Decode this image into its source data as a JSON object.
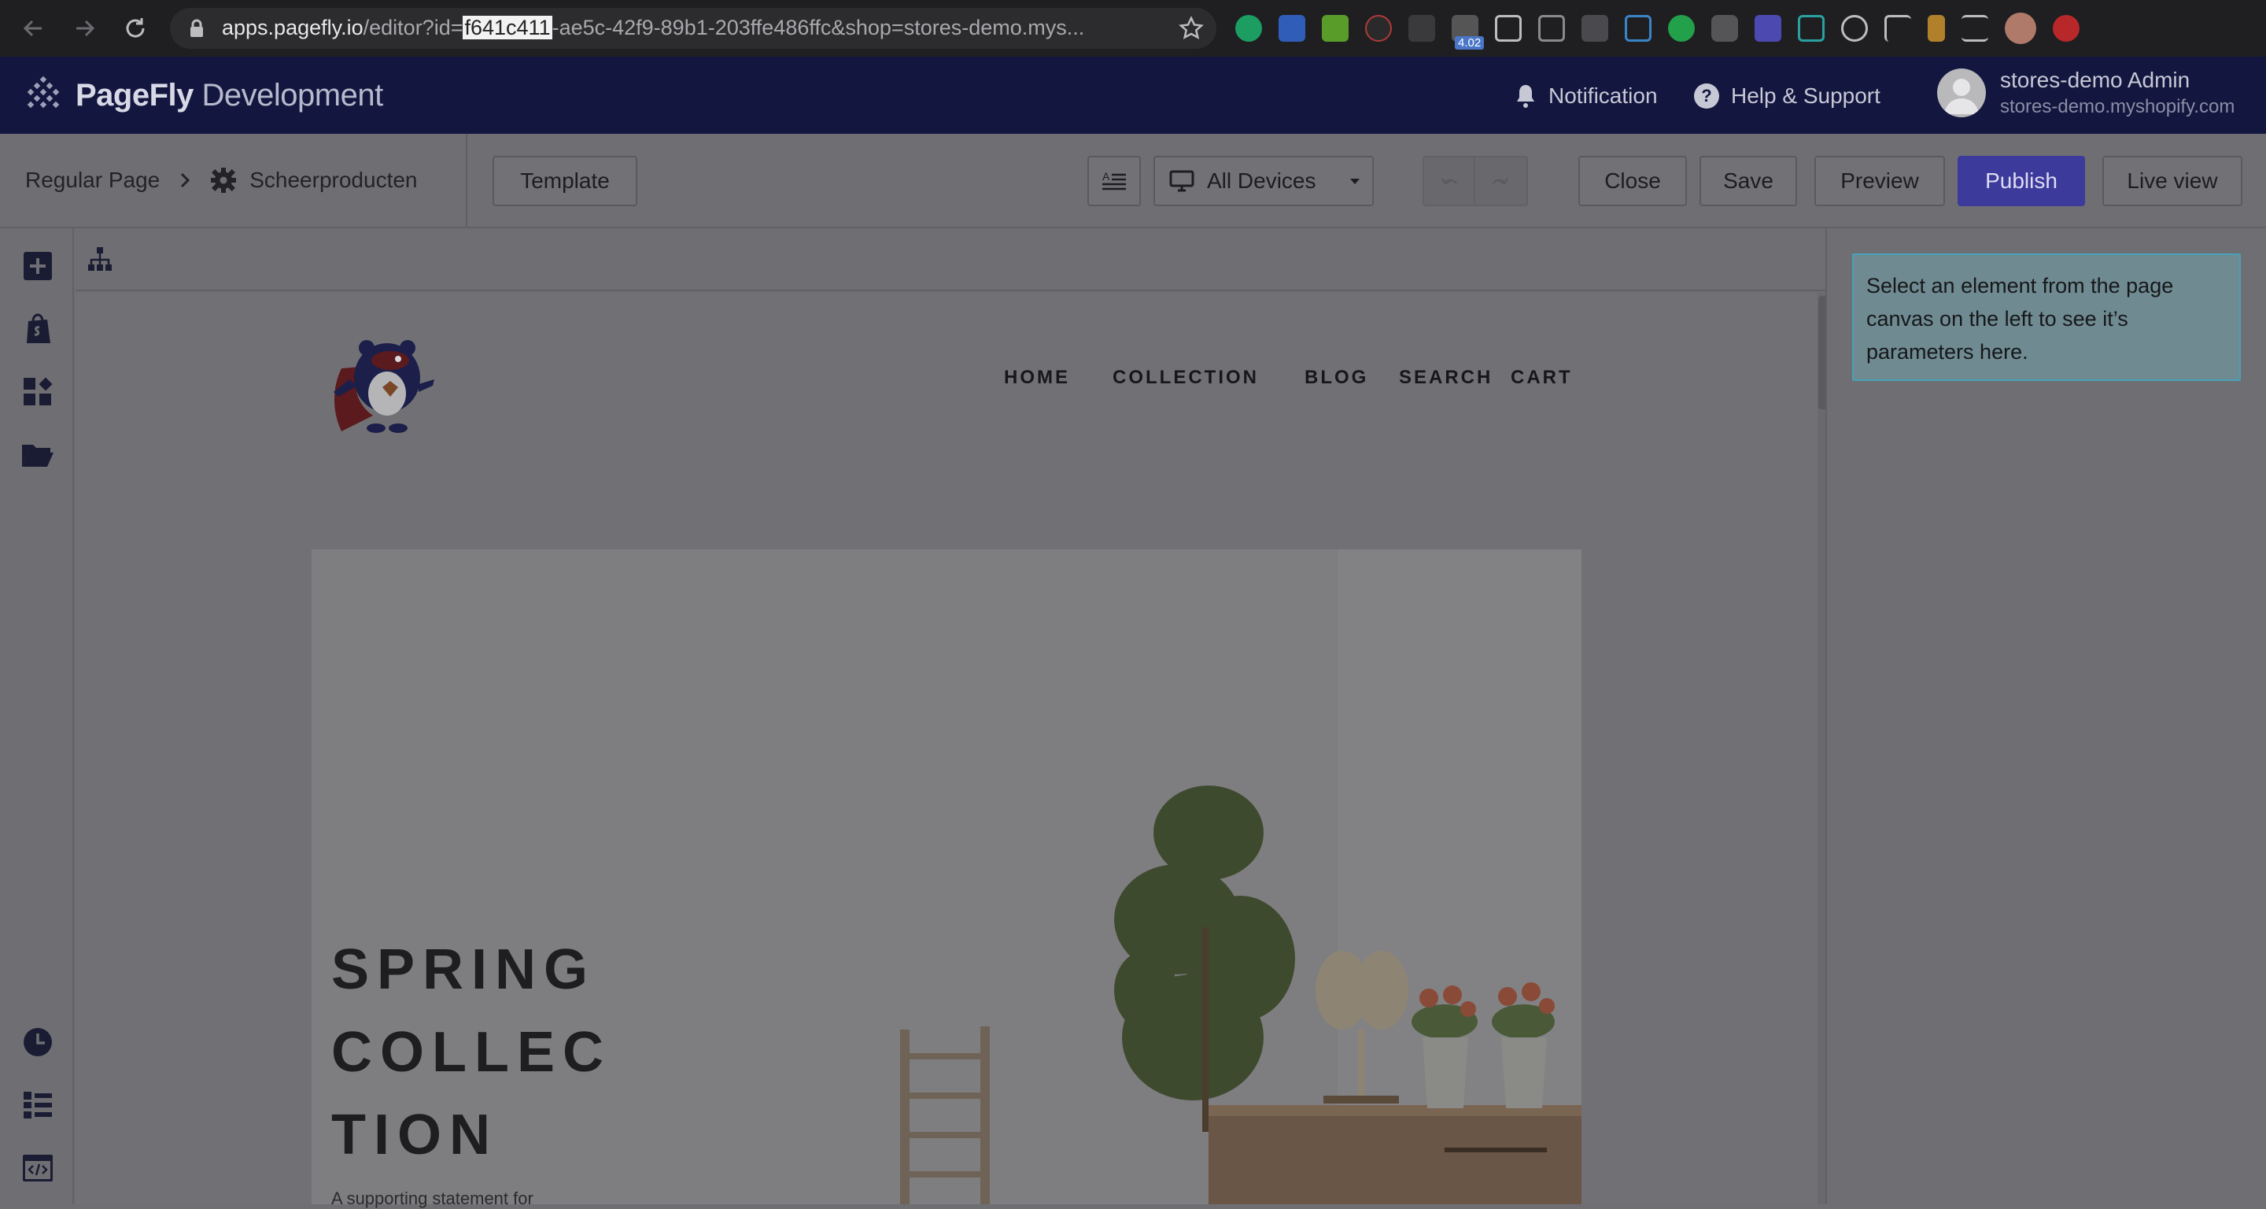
{
  "browser": {
    "url_host": "apps.pagefly.io",
    "url_path_before": "/editor?id=",
    "url_highlight": "f641c411",
    "url_rest": "-ae5c-42f9-89b1-203ffe486ffc&shop=stores-demo.mys...",
    "extension_badge": "4.02",
    "extensions": [
      "grammarly-icon",
      "translate-icon",
      "green-ext-icon",
      "k-ext-icon",
      "dots-ext-icon",
      "timer-ext-icon",
      "screenshot-icon",
      "image-icon",
      "code-ext-icon",
      "calendar-ext-icon",
      "leaf-ext-icon",
      "camera-icon",
      "diamond-ext-icon",
      "n-ext-icon",
      "magnifier-ext-icon",
      "f-ext-icon",
      "hammer-ext-icon",
      "reading-list-icon",
      "profile-avatar",
      "update-icon"
    ]
  },
  "header": {
    "brand": "PageFly",
    "brand_suffix": "Development",
    "notification": "Notification",
    "help": "Help & Support",
    "user_name": "stores-demo Admin",
    "user_shop": "stores-demo.myshopify.com"
  },
  "toolbar": {
    "breadcrumb_root": "Regular Page",
    "page_name": "Scheerproducten",
    "template": "Template",
    "devices": "All Devices",
    "close": "Close",
    "save": "Save",
    "preview": "Preview",
    "publish": "Publish",
    "live_view": "Live view"
  },
  "site": {
    "nav": [
      "HOME",
      "COLLECTION",
      "BLOG",
      "SEARCH",
      "CART"
    ],
    "hero_title_lines": [
      "SPRING",
      "COLLEC",
      "TION"
    ],
    "hero_subtitle": "A supporting statement for"
  },
  "inspector": {
    "message": "Select an element from the page canvas on the left to see it’s parameters here."
  },
  "colors": {
    "appbar": "#13173f",
    "publish": "#3c3a9a",
    "inspector_border": "#47a1b6"
  }
}
